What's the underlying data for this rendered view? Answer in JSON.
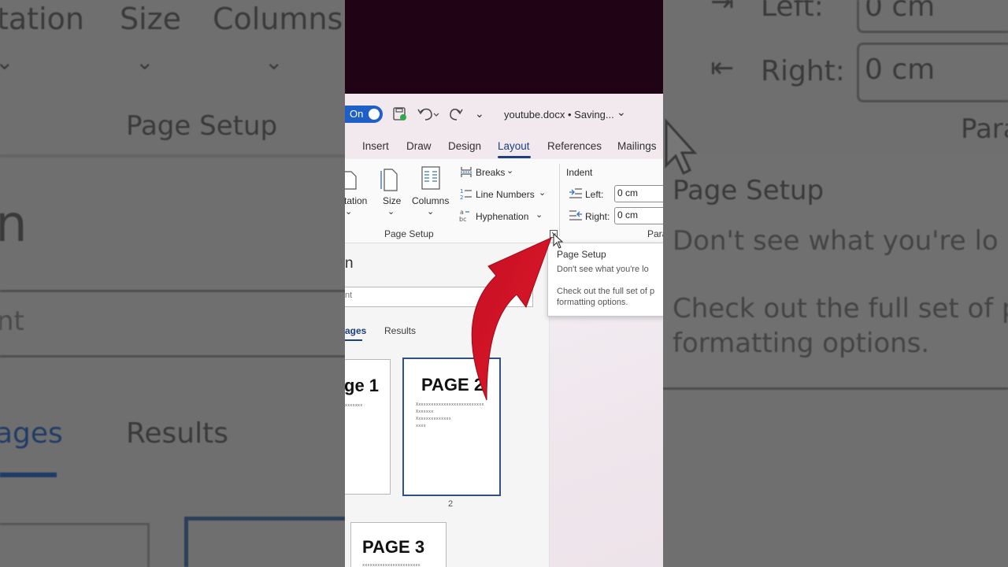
{
  "app": {
    "autosave_toggle": "On",
    "title": "youtube.docx",
    "title_status": "• Saving...",
    "qat_more": "⌄"
  },
  "tabs": [
    "Insert",
    "Draw",
    "Design",
    "Layout",
    "References",
    "Mailings"
  ],
  "active_tab": "Layout",
  "ribbon": {
    "orientation_label": "tation",
    "size_label": "Size",
    "columns_label": "Columns",
    "breaks_label": "Breaks",
    "line_numbers_label": "Line Numbers",
    "hyphenation_label": "Hyphenation",
    "page_setup_group": "Page Setup",
    "paragraph_group": "Para",
    "indent": {
      "heading": "Indent",
      "left_label": "Left:",
      "left_value": "0 cm",
      "right_label": "Right:",
      "right_value": "0 cm"
    }
  },
  "tooltip": {
    "title": "Page Setup",
    "line1": "Don't see what you're lo",
    "line2": "Check out the full set of p",
    "line3": "formatting options."
  },
  "nav_pane": {
    "title": "n",
    "search_text": "nt",
    "tabs": [
      "ages",
      "Results"
    ],
    "page_numbers": [
      "2"
    ],
    "thumbnails": [
      {
        "title": "ge 1",
        "lines": [
          "xxxxxxx"
        ]
      },
      {
        "title": "PAGE 2",
        "lines": [
          "Xxxxxxxxxxxxxxxxxxxxxxxxxxx",
          "Xxxxxxx",
          "Xxxxxxxxxxxxxx",
          "xxxx"
        ]
      },
      {
        "title": "PAGE 3",
        "lines": [
          "xxxxxxxxxxxxxxxxxxxxxxx"
        ]
      }
    ]
  },
  "background": {
    "left": {
      "orientation": "tation",
      "size": "Size",
      "columns": "Columns",
      "group": "Page Setup",
      "pane_title": "n",
      "search": "nt",
      "tab_pages": "ages",
      "tab_results": "Results"
    },
    "right": {
      "left_label": "Left:",
      "left_value": "0 cm",
      "right_label": "Right:",
      "right_value": "0 cm",
      "group": "Para",
      "tip_title": "Page Setup",
      "tip_line1": "Don't see what you're lo",
      "tip_line2": "Check out the full set of p",
      "tip_line3": "formatting options."
    }
  },
  "colors": {
    "accent": "#1c3f80",
    "toggle": "#1f5fc8",
    "arrow": "#d41226",
    "titlebar_dark": "#210316"
  }
}
